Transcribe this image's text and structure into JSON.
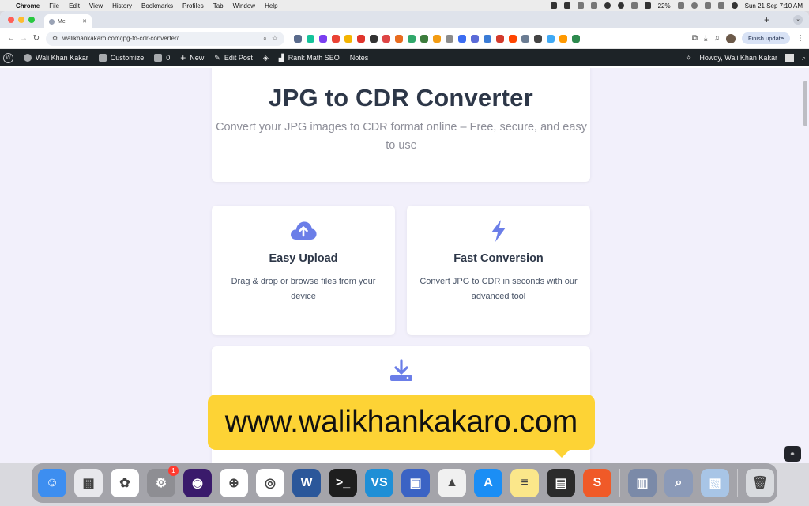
{
  "menubar": {
    "app": "Chrome",
    "items": [
      "File",
      "Edit",
      "View",
      "History",
      "Bookmarks",
      "Profiles",
      "Tab",
      "Window",
      "Help"
    ],
    "battery": "22%",
    "datetime": "Sun 21 Sep  7:10 AM"
  },
  "browser": {
    "tab_title": "Me",
    "new_tab": "+",
    "url": "walikhankakaro.com/jpg-to-cdr-converter/",
    "finish_update": "Finish update",
    "extensions": [
      {
        "icon": "shield-extension-icon",
        "color": "#5a6b8c"
      },
      {
        "icon": "grammarly-icon",
        "color": "#15c39a"
      },
      {
        "icon": "extension-badge-icon",
        "color": "#7a3ef0"
      },
      {
        "icon": "gmail-icon",
        "color": "#ea4335"
      },
      {
        "icon": "copy-extension-icon",
        "color": "#f4b400"
      },
      {
        "icon": "color-picker-icon",
        "color": "#e0342c"
      },
      {
        "icon": "dark-extension-icon",
        "color": "#333333"
      },
      {
        "icon": "rank-extension-icon",
        "color": "#de4545"
      },
      {
        "icon": "pin-extension-icon",
        "color": "#e86b1f"
      },
      {
        "icon": "tool-extension-icon",
        "color": "#30a86b"
      },
      {
        "icon": "tag-extension-icon",
        "color": "#3d7d3d"
      },
      {
        "icon": "bolt-extension-icon",
        "color": "#f39c12"
      },
      {
        "icon": "u-extension-icon",
        "color": "#8c8c8c"
      },
      {
        "icon": "blue-circle-extension-icon",
        "color": "#3b6cf2"
      },
      {
        "icon": "d-extension-icon",
        "color": "#5b6bd8"
      },
      {
        "icon": "check-extension-icon",
        "color": "#3a7bd5"
      },
      {
        "icon": "robot-extension-icon",
        "color": "#d33a2c"
      },
      {
        "icon": "reddit-icon",
        "color": "#ff4500"
      },
      {
        "icon": "link-extension-icon",
        "color": "#6b7c93"
      },
      {
        "icon": "meter-extension-icon",
        "color": "#444444"
      },
      {
        "icon": "m-extension-icon",
        "color": "#3fa9f5"
      },
      {
        "icon": "amazon-icon",
        "color": "#ff9900"
      },
      {
        "icon": "ai-extension-icon",
        "color": "#2d8a4e"
      }
    ]
  },
  "adminbar": {
    "site_name": "Wali Khan Kakar",
    "customize": "Customize",
    "comments_count": "0",
    "new": "New",
    "edit_post": "Edit Post",
    "rank_math": "Rank Math SEO",
    "notes": "Notes",
    "howdy": "Howdy, Wali Khan Kakar"
  },
  "hero": {
    "title": "JPG to CDR Converter",
    "subtitle": "Convert your JPG images to CDR format online – Free, secure, and easy to use"
  },
  "features": [
    {
      "title": "Easy Upload",
      "text": "Drag & drop or browse files from your device",
      "icon": "cloud-upload-icon"
    },
    {
      "title": "Fast Conversion",
      "text": "Convert JPG to CDR in seconds with our advanced tool",
      "icon": "lightning-bolt-icon"
    }
  ],
  "third_card_icon": "download-icon",
  "accent_color": "#6b7ee8",
  "watermark": "www.walikhankakaro.com",
  "dock": [
    {
      "name": "finder-icon",
      "bg": "#3d8ef0",
      "glyph": "☺"
    },
    {
      "name": "launchpad-icon",
      "bg": "#e8e8ec",
      "glyph": "▦"
    },
    {
      "name": "photos-icon",
      "bg": "#ffffff",
      "glyph": "✿"
    },
    {
      "name": "system-settings-icon",
      "bg": "#8e8e93",
      "glyph": "⚙",
      "badge": "1"
    },
    {
      "name": "firefox-icon",
      "bg": "#3a1a6b",
      "glyph": "◉"
    },
    {
      "name": "safari-icon",
      "bg": "#ffffff",
      "glyph": "⊕"
    },
    {
      "name": "chrome-icon",
      "bg": "#ffffff",
      "glyph": "◎"
    },
    {
      "name": "word-icon",
      "bg": "#2b579a",
      "glyph": "W"
    },
    {
      "name": "terminal-icon",
      "bg": "#1e1e1e",
      "glyph": ">_"
    },
    {
      "name": "vs-app-icon",
      "bg": "#1f8fd6",
      "glyph": "VS"
    },
    {
      "name": "blue-square-app-icon",
      "bg": "#3b63c4",
      "glyph": "▣"
    },
    {
      "name": "vlc-icon",
      "bg": "#f0f0f0",
      "glyph": "▲"
    },
    {
      "name": "app-store-icon",
      "bg": "#1b8ef5",
      "glyph": "A"
    },
    {
      "name": "notes-icon",
      "bg": "#fbe78a",
      "glyph": "≡"
    },
    {
      "name": "activity-monitor-icon",
      "bg": "#2b2b2b",
      "glyph": "▤"
    },
    {
      "name": "s-app-icon",
      "bg": "#f05a28",
      "glyph": "S"
    },
    {
      "name": "separator"
    },
    {
      "name": "folder-stack-icon",
      "bg": "#7b8aa8",
      "glyph": "▥"
    },
    {
      "name": "preview-stack-icon",
      "bg": "#8b9ab8",
      "glyph": "⌕"
    },
    {
      "name": "screenshot-stack-icon",
      "bg": "#a8c5e6",
      "glyph": "▧"
    },
    {
      "name": "separator"
    },
    {
      "name": "trash-icon",
      "bg": "#d8dade",
      "glyph": "🗑"
    }
  ]
}
